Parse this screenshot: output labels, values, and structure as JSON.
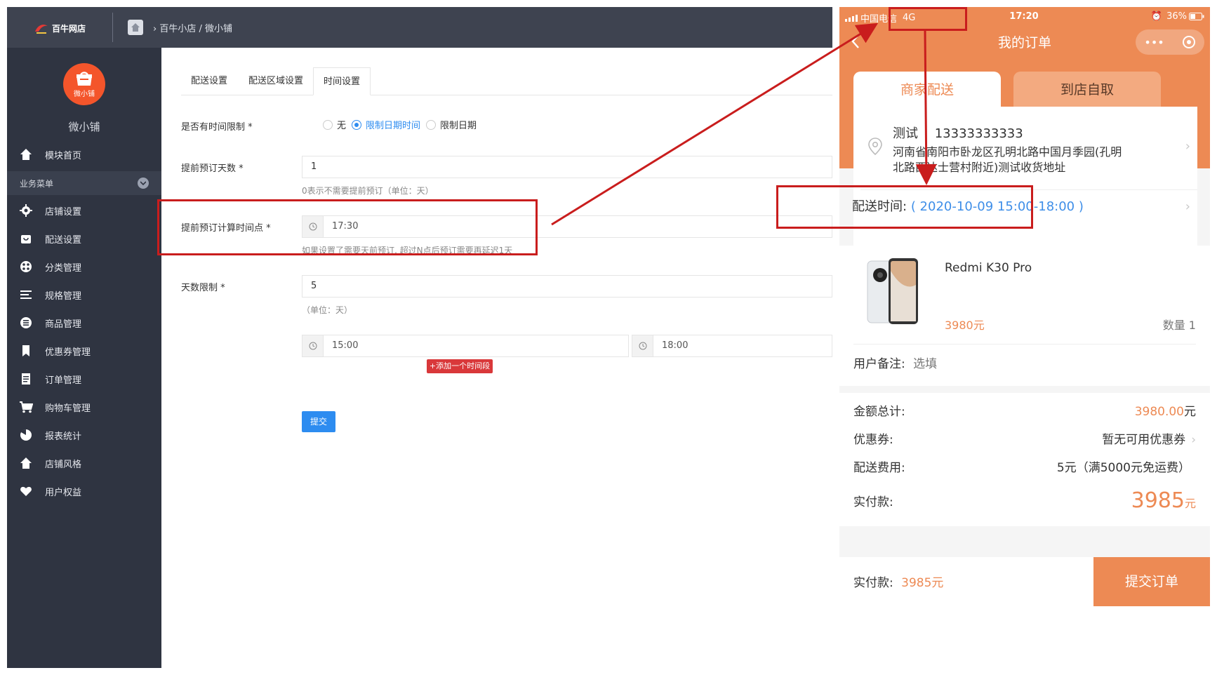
{
  "admin": {
    "brand": "百牛网店",
    "breadcrumb": "百牛小店 / 微小铺",
    "store_avatar_label": "微小铺",
    "store_name": "微小铺",
    "sidebar": {
      "top_item": "模块首页",
      "section_title": "业务菜单",
      "items": [
        "店铺设置",
        "配送设置",
        "分类管理",
        "规格管理",
        "商品管理",
        "优惠券管理",
        "订单管理",
        "购物车管理",
        "报表统计",
        "店铺风格",
        "用户权益"
      ]
    },
    "tabs": [
      "配送设置",
      "配送区域设置",
      "时间设置"
    ],
    "active_tab": "时间设置",
    "form": {
      "time_limit_label": "是否有时间限制 *",
      "time_limit_options": [
        "无",
        "限制日期时间",
        "限制日期"
      ],
      "time_limit_selected": "限制日期时间",
      "advance_days_label": "提前预订天数 *",
      "advance_days_value": "1",
      "advance_days_hint": "0表示不需要提前预订（单位：天）",
      "cutoff_label": "提前预订计算时间点 *",
      "cutoff_value": "17:30",
      "cutoff_hint": "如果设置了需要天前预订, 超过N点后预订需要再延迟1天",
      "day_limit_label": "天数限制 *",
      "day_limit_value": "5",
      "day_limit_hint": "（单位：天）",
      "slot_start": "15:00",
      "slot_end": "18:00",
      "add_slot_label": "+添加一个时间段",
      "submit_label": "提交"
    }
  },
  "phone": {
    "status": {
      "carrier": "中国电信",
      "network": "4G",
      "time": "17:20",
      "battery": "36%"
    },
    "title": "我的订单",
    "delivery_tabs": [
      "商家配送",
      "到店自取"
    ],
    "active_delivery_tab": "商家配送",
    "contact_name": "测试",
    "contact_phone": "13333333333",
    "address": "河南省南阳市卧龙区孔明北路中国月季园(孔明北路西达士营村附近)测试收货地址",
    "delivery_time_label": "配送时间:",
    "delivery_time_value": "( 2020-10-09 15:00-18:00 )",
    "goods": {
      "name": "Redmi K30 Pro",
      "price": "3980元",
      "qty": "数量 1"
    },
    "remark_label": "用户备注:",
    "remark_placeholder": "选填",
    "summary": {
      "total_label": "金额总计:",
      "total_value": "3980.00",
      "total_unit": "元",
      "coupon_label": "优惠券:",
      "coupon_value": "暂无可用优惠券",
      "shipping_label": "配送费用:",
      "shipping_value": "5元（满5000元免运费）",
      "paid_label": "实付款:",
      "paid_value": "3985",
      "paid_unit": "元"
    },
    "bottom": {
      "paid_label": "实付款:",
      "paid_value": "3985元",
      "submit_label": "提交订单"
    }
  },
  "colors": {
    "accent_orange": "#ed8a54",
    "highlight_red": "#c91d1d",
    "primary_blue": "#2d8cf0",
    "sidebar_bg": "#2f3441"
  }
}
